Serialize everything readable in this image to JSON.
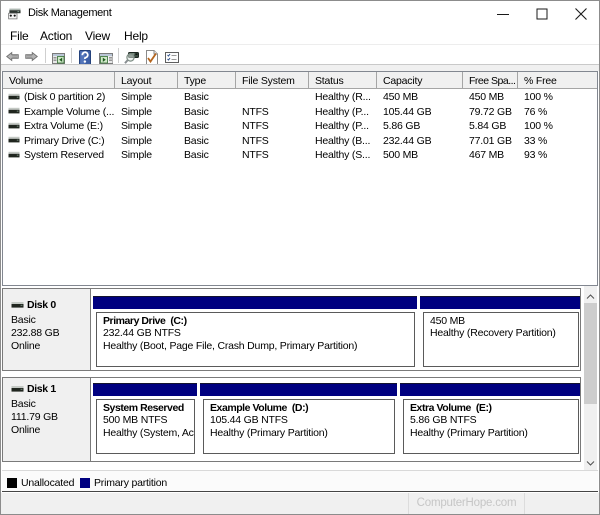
{
  "window": {
    "title": "Disk Management"
  },
  "menu": {
    "items": [
      "File",
      "Action",
      "View",
      "Help"
    ]
  },
  "toolbar": {
    "buttons": [
      "back",
      "forward",
      "show-hide-console-tree",
      "help",
      "show-hide-action-pane",
      "rescan-disks",
      "check-disk",
      "properties"
    ]
  },
  "volume_list": {
    "columns": [
      "Volume",
      "Layout",
      "Type",
      "File System",
      "Status",
      "Capacity",
      "Free Spa...",
      "% Free"
    ],
    "rows": [
      {
        "volume": "(Disk 0 partition 2)",
        "layout": "Simple",
        "type": "Basic",
        "file_system": "",
        "status": "Healthy (R...",
        "capacity": "450 MB",
        "free_space": "450 MB",
        "pct_free": "100 %"
      },
      {
        "volume": "Example Volume (...",
        "layout": "Simple",
        "type": "Basic",
        "file_system": "NTFS",
        "status": "Healthy (P...",
        "capacity": "105.44 GB",
        "free_space": "79.72 GB",
        "pct_free": "76 %"
      },
      {
        "volume": "Extra Volume (E:)",
        "layout": "Simple",
        "type": "Basic",
        "file_system": "NTFS",
        "status": "Healthy (P...",
        "capacity": "5.86 GB",
        "free_space": "5.84 GB",
        "pct_free": "100 %"
      },
      {
        "volume": "Primary Drive (C:)",
        "layout": "Simple",
        "type": "Basic",
        "file_system": "NTFS",
        "status": "Healthy (B...",
        "capacity": "232.44 GB",
        "free_space": "77.01 GB",
        "pct_free": "33 %"
      },
      {
        "volume": "System Reserved",
        "layout": "Simple",
        "type": "Basic",
        "file_system": "NTFS",
        "status": "Healthy (S...",
        "capacity": "500 MB",
        "free_space": "467 MB",
        "pct_free": "93 %"
      }
    ]
  },
  "disks": [
    {
      "name": "Disk 0",
      "type": "Basic",
      "size": "232.88 GB",
      "status": "Online",
      "partitions": [
        {
          "title": "Primary Drive  (C:)",
          "size": "232.44 GB NTFS",
          "health": "Healthy (Boot, Page File, Crash Dump, Primary Partition)"
        },
        {
          "title": "",
          "size": "450 MB",
          "health": "Healthy (Recovery Partition)"
        }
      ]
    },
    {
      "name": "Disk 1",
      "type": "Basic",
      "size": "111.79 GB",
      "status": "Online",
      "partitions": [
        {
          "title": "System Reserved",
          "size": "500 MB NTFS",
          "health": "Healthy (System, Active, Primary Partition)"
        },
        {
          "title": "Example Volume  (D:)",
          "size": "105.44 GB NTFS",
          "health": "Healthy (Primary Partition)"
        },
        {
          "title": "Extra Volume  (E:)",
          "size": "5.86 GB NTFS",
          "health": "Healthy (Primary Partition)"
        }
      ]
    }
  ],
  "legend": {
    "items": [
      {
        "label": "Unallocated",
        "color": "#000000"
      },
      {
        "label": "Primary partition",
        "color": "#000080"
      }
    ]
  },
  "watermark": "ComputerHope.com",
  "colors": {
    "partition_bar": "#000080"
  }
}
